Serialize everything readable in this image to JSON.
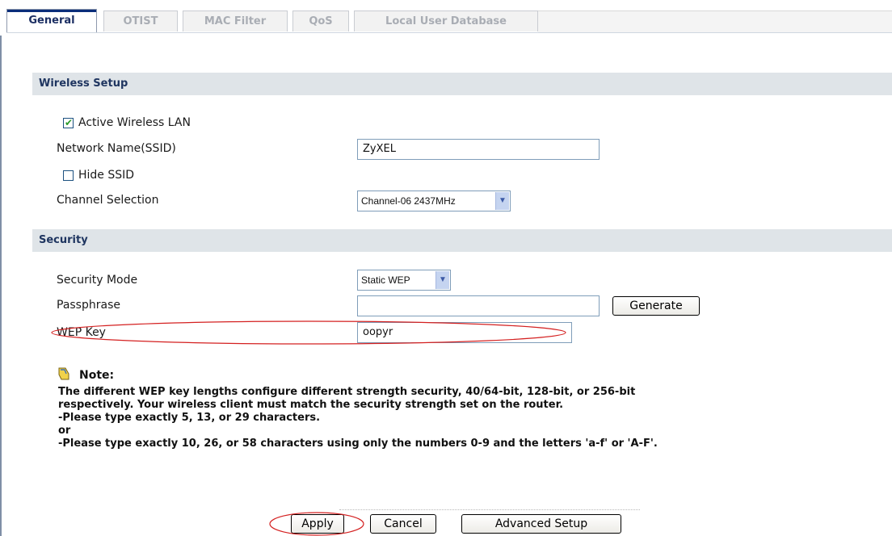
{
  "tabs": [
    {
      "label": "General",
      "active": true
    },
    {
      "label": "OTIST",
      "active": false
    },
    {
      "label": "MAC Filter",
      "active": false
    },
    {
      "label": "QoS",
      "active": false
    },
    {
      "label": "Local User Database",
      "active": false
    }
  ],
  "wireless_setup": {
    "title": "Wireless Setup",
    "active_wlan": {
      "label": "Active Wireless LAN",
      "checked": true
    },
    "ssid": {
      "label": "Network Name(SSID)",
      "value": "ZyXEL"
    },
    "hide_ssid": {
      "label": "Hide SSID",
      "checked": false
    },
    "channel": {
      "label": "Channel Selection",
      "value": "Channel-06 2437MHz"
    }
  },
  "security": {
    "title": "Security",
    "mode": {
      "label": "Security Mode",
      "value": "Static WEP"
    },
    "passphrase": {
      "label": "Passphrase",
      "value": ""
    },
    "generate_button": "Generate",
    "wep_key": {
      "label": "WEP Key",
      "value": "oopyr"
    }
  },
  "note": {
    "title": "Note:",
    "lines": [
      "The different WEP key lengths configure different strength security, 40/64-bit, 128-bit, or 256-bit",
      "respectively. Your wireless client must match the security strength set on the router.",
      "-Please type exactly 5, 13, or 29 characters.",
      "or",
      "-Please type exactly 10, 26, or 58 characters using only the numbers 0-9 and the letters 'a-f' or 'A-F'."
    ]
  },
  "buttons": {
    "apply": "Apply",
    "cancel": "Cancel",
    "advanced": "Advanced Setup"
  },
  "colors": {
    "section_bar": "#dfe4e8",
    "section_text": "#1f3560",
    "active_tab_accent": "#0a2d7a",
    "annotation_ellipse": "#d42020"
  }
}
